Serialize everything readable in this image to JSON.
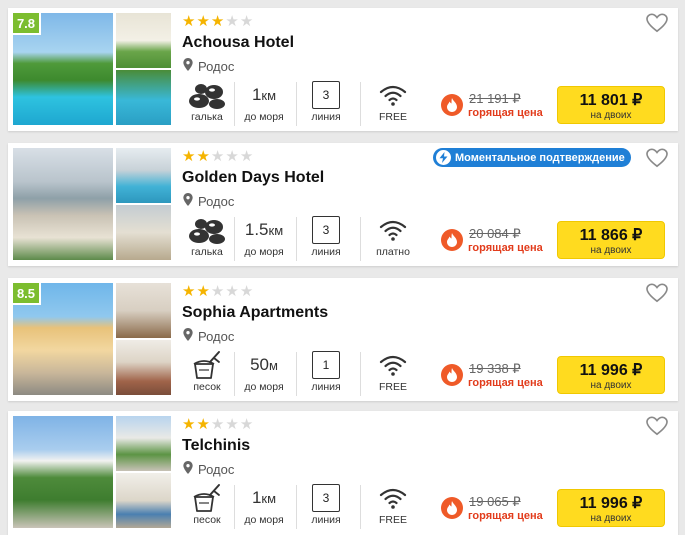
{
  "common": {
    "distance_label": "до моря",
    "line_label": "линия",
    "hot_label": "горящая цена",
    "price_for": "на двоих",
    "instant_label": "Моментальное подтверждение",
    "icons": [
      "heart-icon",
      "pin-icon",
      "wifi-icon",
      "fire-icon",
      "pebble-icon",
      "sand-icon",
      "bolt-icon"
    ],
    "colors": {
      "rating_bg": "#7cbd2f",
      "star": "#f5b400",
      "buy_button": "#ffdb1f",
      "hot": "#e23c1c",
      "badge": "#1f7fd6"
    }
  },
  "hotels": [
    {
      "rating": "7.8",
      "stars": 3,
      "name": "Achousa Hotel",
      "location": "Родос",
      "beach": "галька",
      "distance_value": "1",
      "distance_unit": "км",
      "line": "3",
      "wifi": "FREE",
      "old_price": "21 191 ₽",
      "price": "11 801 ₽",
      "instant": false
    },
    {
      "rating": "",
      "stars": 2,
      "name": "Golden Days Hotel",
      "location": "Родос",
      "beach": "галька",
      "distance_value": "1.5",
      "distance_unit": "км",
      "line": "3",
      "wifi": "платно",
      "old_price": "20 084 ₽",
      "price": "11 866 ₽",
      "instant": true
    },
    {
      "rating": "8.5",
      "stars": 2,
      "name": "Sophia Apartments",
      "location": "Родос",
      "beach": "песок",
      "distance_value": "50",
      "distance_unit": "м",
      "line": "1",
      "wifi": "FREE",
      "old_price": "19 338 ₽",
      "price": "11 996 ₽",
      "instant": false
    },
    {
      "rating": "",
      "stars": 2,
      "name": "Telchinis",
      "location": "Родос",
      "beach": "песок",
      "distance_value": "1",
      "distance_unit": "км",
      "line": "3",
      "wifi": "FREE",
      "old_price": "19 065 ₽",
      "price": "11 996 ₽",
      "instant": false
    }
  ]
}
